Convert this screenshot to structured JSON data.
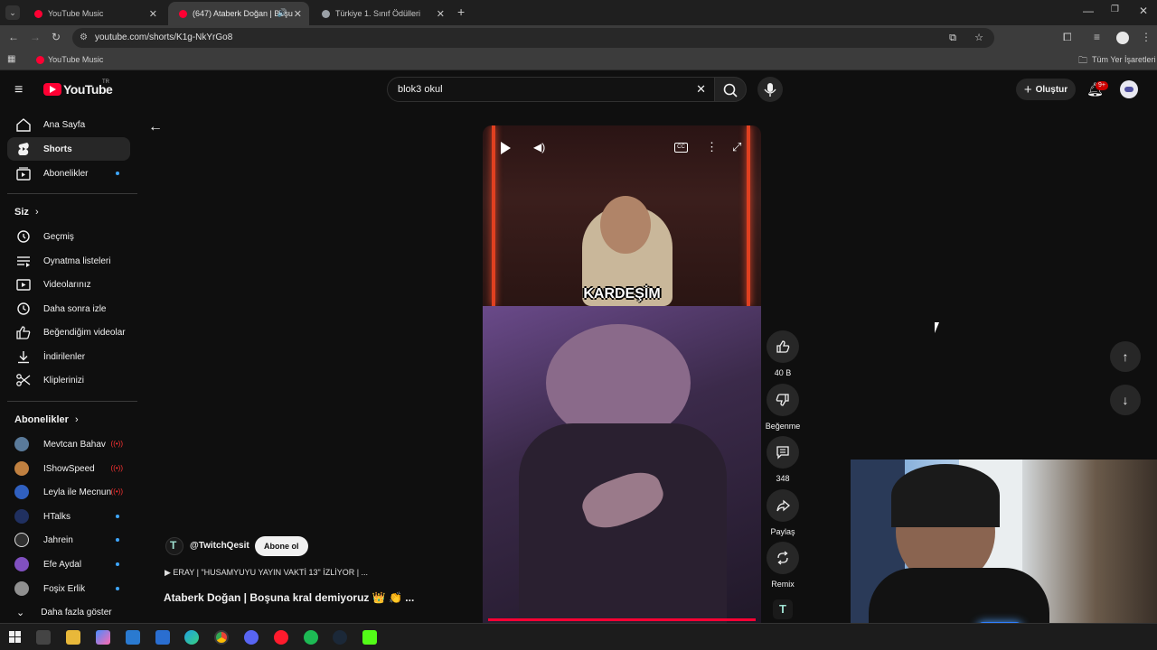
{
  "browser": {
    "tabs": [
      {
        "title": "YouTube Music",
        "favicon_color": "#ff0033"
      },
      {
        "title": "(647) Ataberk Doğan | Boşu",
        "favicon_color": "#ff0033"
      },
      {
        "title": "Türkiye 1. Sınıf Ödülleri",
        "favicon_color": "#9aa0a6"
      }
    ],
    "url": "youtube.com/shorts/K1g-NkYrGo8",
    "bookmarks": {
      "item": "YouTube Music",
      "all": "Tüm Yer İşaretleri"
    }
  },
  "youtube": {
    "logo_text": "YouTube",
    "region": "TR",
    "search_value": "blok3 okul",
    "create_label": "Oluştur",
    "notification_count": "9+",
    "sidebar": {
      "main": [
        {
          "label": "Ana Sayfa",
          "icon": "home-icon"
        },
        {
          "label": "Shorts",
          "icon": "shorts-icon",
          "active": true
        },
        {
          "label": "Abonelikler",
          "icon": "subscriptions-icon"
        }
      ],
      "you_header": "Siz",
      "you": [
        {
          "label": "Geçmiş",
          "icon": "history-icon"
        },
        {
          "label": "Oynatma listeleri",
          "icon": "playlist-icon"
        },
        {
          "label": "Videolarınız",
          "icon": "your-videos-icon"
        },
        {
          "label": "Daha sonra izle",
          "icon": "watch-later-icon"
        },
        {
          "label": "Beğendiğim videolar",
          "icon": "liked-icon"
        },
        {
          "label": "İndirilenler",
          "icon": "download-icon"
        },
        {
          "label": "Kliplerinizi",
          "icon": "clips-icon"
        }
      ],
      "subs_header": "Abonelikler",
      "subs": [
        {
          "label": "Mevtcan Bahav",
          "status": "live",
          "avatar_color": "#5a7a9a"
        },
        {
          "label": "IShowSpeed",
          "status": "live",
          "avatar_color": "#c08040"
        },
        {
          "label": "Leyla ile Mecnun",
          "status": "live",
          "avatar_color": "#3060c0"
        },
        {
          "label": "HTalks",
          "status": "new",
          "avatar_color": "#203060"
        },
        {
          "label": "Jahrein",
          "status": "new",
          "avatar_color": "#303030"
        },
        {
          "label": "Efe Aydal",
          "status": "new",
          "avatar_color": "#8050c0"
        },
        {
          "label": "Foşix Erlik",
          "status": "new",
          "avatar_color": "#909090"
        }
      ],
      "more": "Daha fazla göster"
    },
    "short": {
      "caption_word": "KARDEŞİM",
      "channel": "@TwitchQesit",
      "subscribe": "Abone ol",
      "linked_video": "ERAY | \"HUSAMYUYU YAYIN VAKTİ 13\" İZLİYOR | ...",
      "title": "Ataberk Doğan | Boşuna kral demiyoruz 👑 👏 ...",
      "progress": 1.0
    },
    "actions": [
      {
        "label": "40 B",
        "icon": "like-icon"
      },
      {
        "label": "Beğenme",
        "icon": "dislike-icon"
      },
      {
        "label": "348",
        "icon": "comment-icon"
      },
      {
        "label": "Paylaş",
        "icon": "share-icon"
      },
      {
        "label": "Remix",
        "icon": "remix-icon"
      }
    ]
  },
  "colors": {
    "accent": "#ff0033",
    "blue": "#3ea6ff",
    "bg": "#0f0f0f"
  }
}
